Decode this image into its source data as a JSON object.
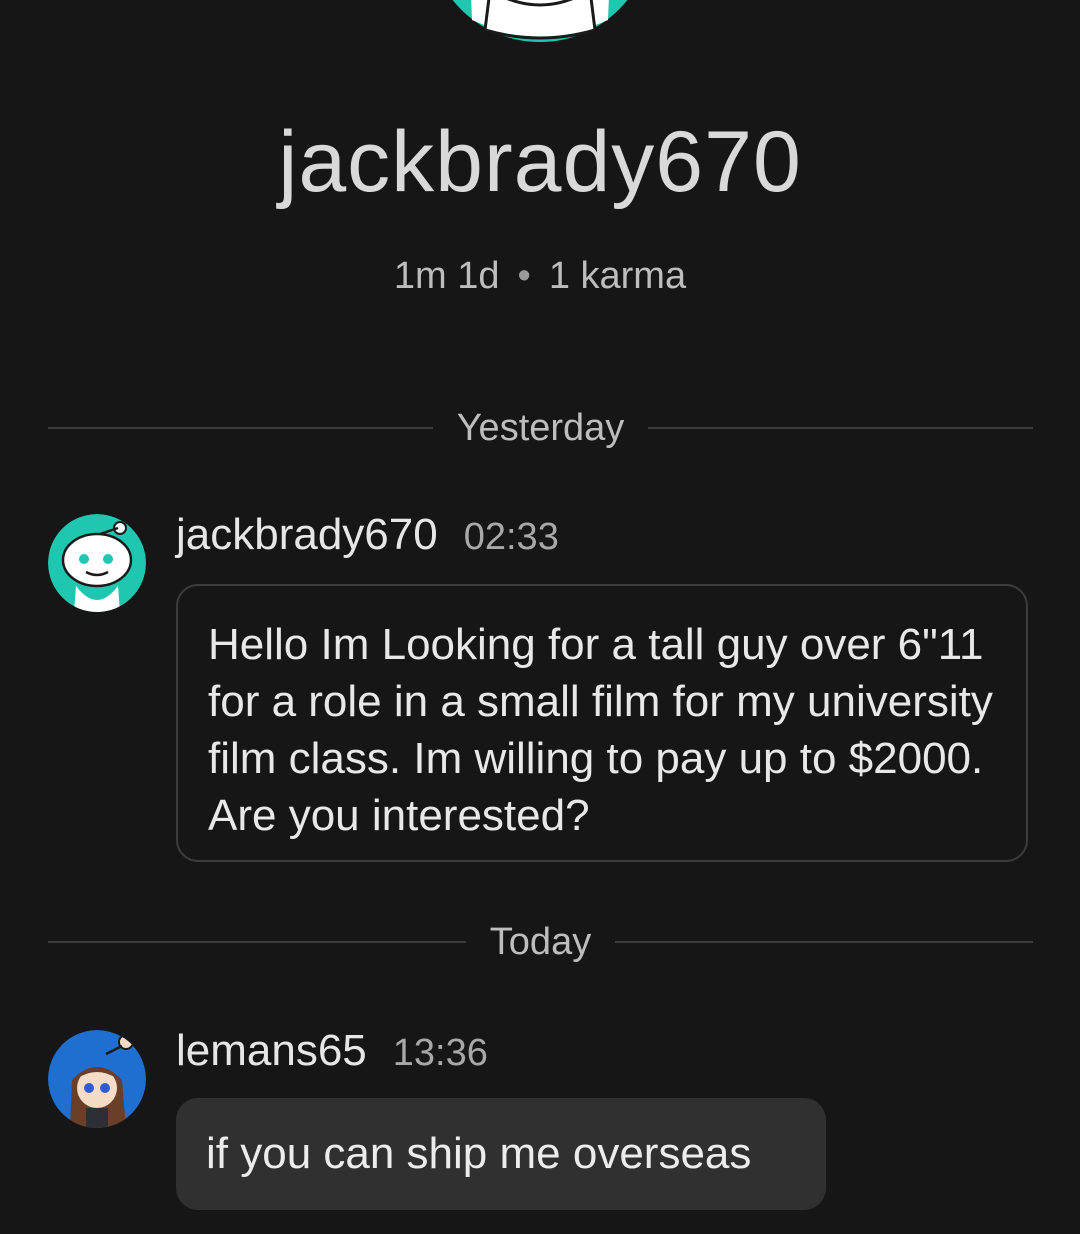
{
  "profile": {
    "username": "jackbrady670",
    "account_age": "1m 1d",
    "karma": "1 karma"
  },
  "dividers": {
    "yesterday": "Yesterday",
    "today": "Today"
  },
  "messages": [
    {
      "author": "jackbrady670",
      "time": "02:33",
      "text": "Hello Im Looking for a tall guy over 6\"11 for a role in a small film for my university film class. Im willing to pay up to $2000. Are you interested?"
    },
    {
      "author": "lemans65",
      "time": "13:36",
      "text": "if you can ship me overseas"
    }
  ],
  "colors": {
    "background": "#161616",
    "snoo_teal": "#1fc7b0",
    "lemans_avatar_blue": "#1e6fd0"
  },
  "icons": {
    "profile_avatar": "snoo-avatar-icon",
    "jackbrady_avatar": "snoo-avatar-icon",
    "lemans_avatar": "anime-girl-avatar-icon"
  }
}
